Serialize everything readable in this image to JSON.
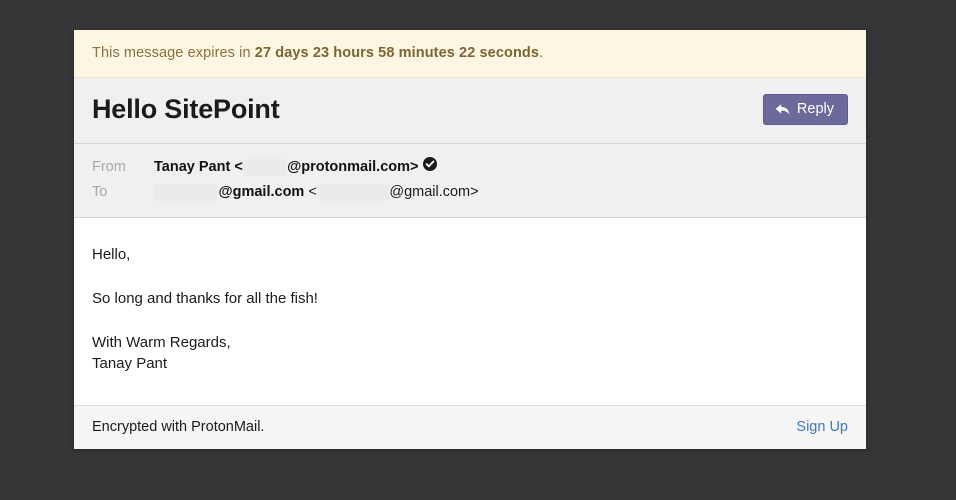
{
  "banner": {
    "prefix": "This message expires in ",
    "countdown": "27 days 23 hours 58 minutes 22 seconds",
    "suffix": ".",
    "background_color": "#fdf6e3",
    "text_color": "#8a7040"
  },
  "header": {
    "subject": "Hello SitePoint",
    "reply_label": "Reply",
    "reply_icon": "reply-arrow-icon",
    "reply_bg_color": "#6b6a9b"
  },
  "addresses": {
    "from": {
      "label": "From",
      "name": "Tanay Pant",
      "open_bracket": "<",
      "redacted_user": "           ",
      "domain": "@protonmail.com>",
      "verified_icon": "verified-check-icon"
    },
    "to": {
      "label": "To",
      "redacted_user_1": "                ",
      "domain_1": "@gmail.com",
      "open_bracket": "<",
      "redacted_user_2": "                  ",
      "domain_2": "@gmail.com>"
    }
  },
  "body": {
    "greeting": "Hello,",
    "paragraph": "So long and thanks for all the fish!",
    "closing": "With Warm Regards,",
    "signature": "Tanay Pant"
  },
  "footer": {
    "encrypted_text": "Encrypted with ProtonMail.",
    "signup_label": "Sign Up",
    "signup_color": "#3a7bbf"
  }
}
